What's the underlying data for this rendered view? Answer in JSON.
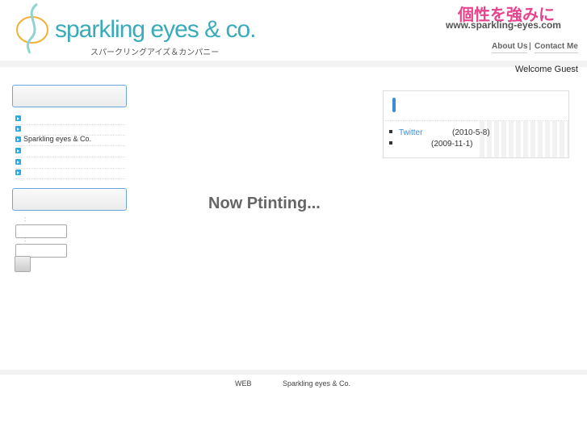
{
  "header": {
    "logo_text": "sparkling eyes & co.",
    "logo_sub": "スパークリングアイズ＆カンパニー",
    "tagline": "個性を強みに",
    "site_url": "www.sparkling-eyes.com",
    "links": [
      "About Us",
      "|",
      "Contact Me"
    ],
    "welcome": "Welcome Guest"
  },
  "sidebar": {
    "menu": [
      "",
      "",
      "Sparkling eyes & Co.",
      "",
      "",
      ""
    ],
    "login": {
      "colon1": ":",
      "colon2": ":"
    }
  },
  "main": {
    "placeholder": "Now Ptinting..."
  },
  "news": {
    "items": [
      {
        "link": "Twitter",
        "date": "(2010-5-8)"
      },
      {
        "link": "",
        "date": "(2009-11-1)"
      }
    ]
  },
  "footer": {
    "left": "WEB",
    "right": "Sparkling eyes & Co."
  }
}
